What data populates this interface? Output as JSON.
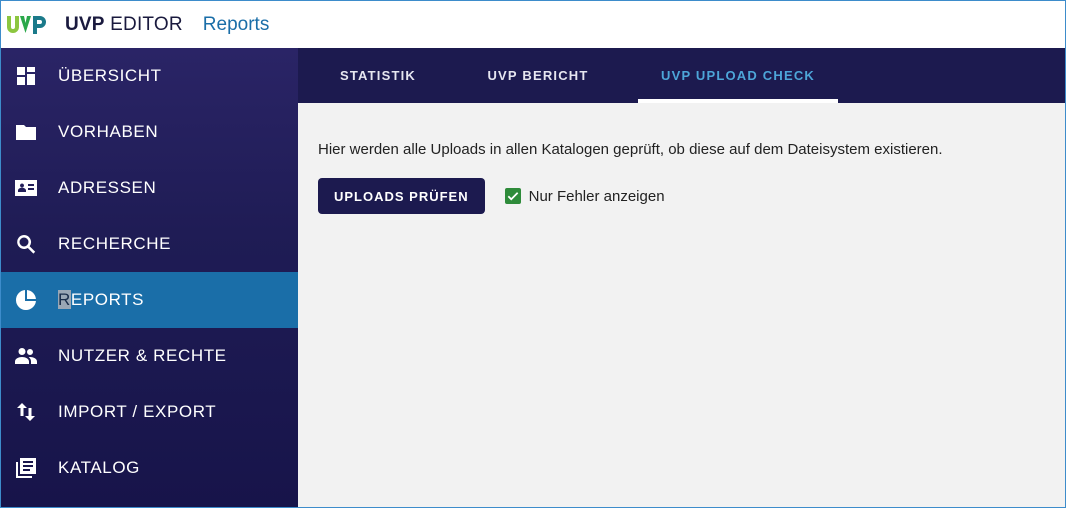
{
  "header": {
    "logo_text": "UVP",
    "app_name_bold": "UVP",
    "app_name_rest": "EDITOR",
    "current_page": "Reports"
  },
  "sidebar": {
    "items": [
      {
        "label": "ÜBERSICHT",
        "icon": "dashboard-icon"
      },
      {
        "label": "VORHABEN",
        "icon": "folder-icon"
      },
      {
        "label": "ADRESSEN",
        "icon": "contact-card-icon"
      },
      {
        "label": "RECHERCHE",
        "icon": "search-icon"
      },
      {
        "label_cursor": "R",
        "label_rest": "EPORTS",
        "icon": "pie-chart-icon",
        "active": true
      },
      {
        "label": "NUTZER & RECHTE",
        "icon": "people-icon"
      },
      {
        "label": "IMPORT / EXPORT",
        "icon": "import-export-icon"
      },
      {
        "label": "KATALOG",
        "icon": "library-books-icon"
      }
    ]
  },
  "tabs": [
    {
      "label": "STATISTIK"
    },
    {
      "label": "UVP BERICHT"
    },
    {
      "label": "UVP UPLOAD CHECK",
      "active": true
    }
  ],
  "main": {
    "description": "Hier werden alle Uploads in allen Katalogen geprüft, ob diese auf dem Dateisystem existieren.",
    "check_button": "UPLOADS PRÜFEN",
    "errors_only_checkbox": {
      "label": "Nur Fehler anzeigen",
      "checked": true
    }
  },
  "colors": {
    "sidebar_bg": "#2a2466",
    "active_item": "#1a6ea8",
    "tab_bar": "#1c1a4f",
    "active_tab_text": "#4da6d9",
    "checkbox": "#2e8b3a"
  }
}
